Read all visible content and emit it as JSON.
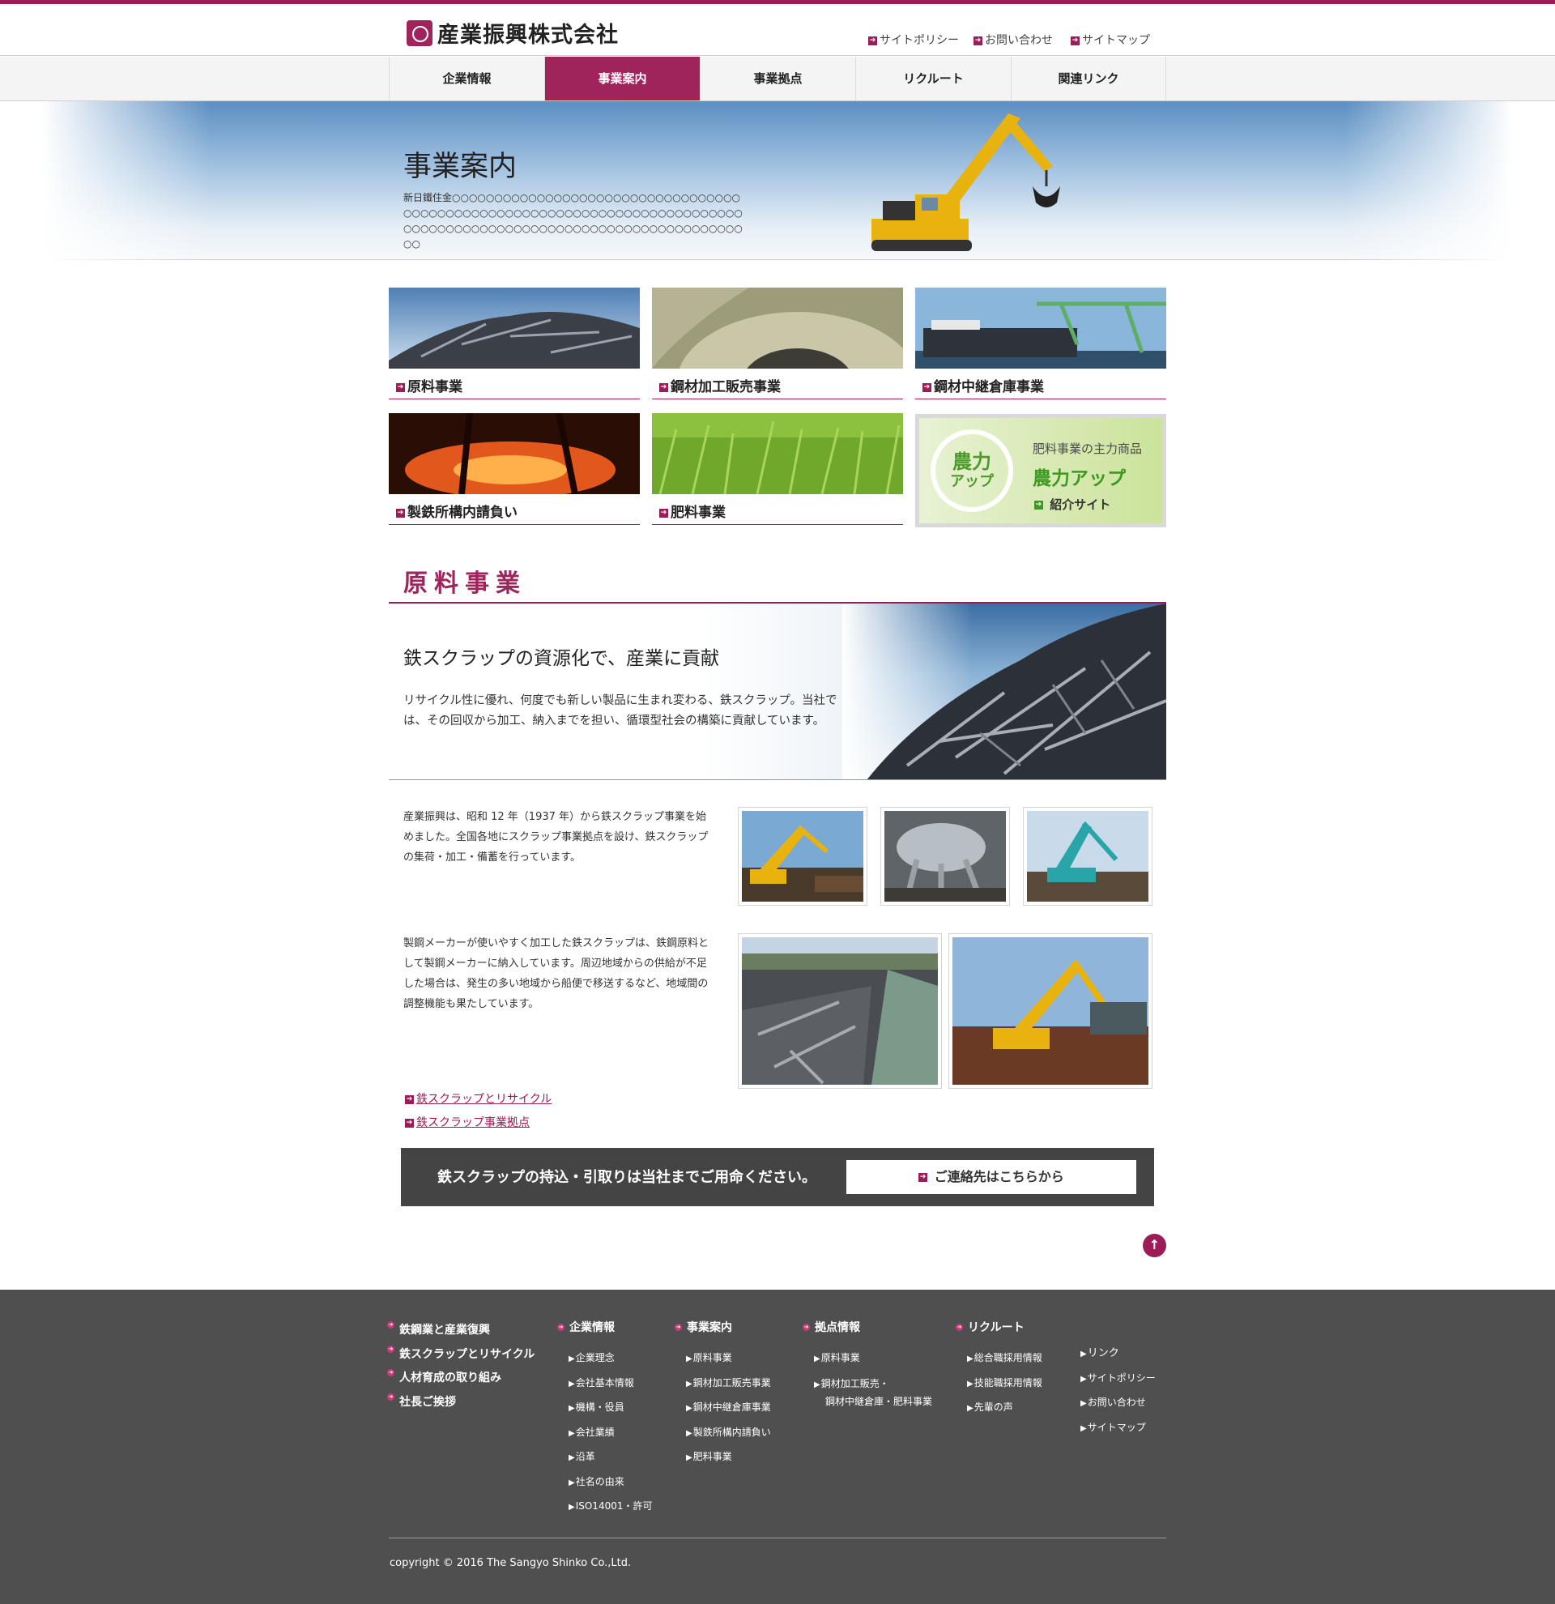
{
  "header": {
    "logo_text": "産業振興株式会社",
    "links": [
      "サイトポリシー",
      "お問い合わせ",
      "サイトマップ"
    ]
  },
  "nav": {
    "items": [
      "企業情報",
      "事業案内",
      "事業拠点",
      "リクルート",
      "関連リンク"
    ],
    "active": "事業案内"
  },
  "hero": {
    "title": "事業案内",
    "text": "新日鐵住金○○○○○○○○○○○○○○○○○○○○○○○○○○○○○○○○○○○○○○○○○○○○○○○○○○○○○○○○○○○○○○○○○○○○○○○○○○○○○○○○○○○○○○○○○○○○○○○○○○○○○○○○○○○○○○○○○○○○"
  },
  "cards": [
    {
      "label": "原料事業"
    },
    {
      "label": "鋼材加工販売事業"
    },
    {
      "label": "鋼材中継倉庫事業"
    },
    {
      "label": "製鉄所構内請負い"
    },
    {
      "label": "肥料事業"
    }
  ],
  "promo": {
    "circle_top": "農力",
    "circle_bottom": "アップ",
    "subtitle": "肥料事業の主力商品",
    "title": "農力アップ",
    "link": "紹介サイト"
  },
  "section": {
    "title": "原料事業",
    "banner_heading": "鉄スクラップの資源化で、産業に貢献",
    "banner_text": "リサイクル性に優れ、何度でも新しい製品に生まれ変わる、鉄スクラップ。当社では、その回収から加工、納入までを担い、循環型社会の構築に貢献しています。",
    "para1": "産業振興は、昭和 12 年（1937 年）から鉄スクラップ事業を始めました。全国各地にスクラップ事業拠点を設け、鉄スクラップの集荷・加工・備蓄を行っています。",
    "para2": "製鋼メーカーが使いやすく加工した鉄スクラップは、鉄鋼原料として製鋼メーカーに納入しています。周辺地域からの供給が不足した場合は、発生の多い地域から船便で移送するなど、地域間の調整機能も果たしています。",
    "links": [
      "鉄スクラップとリサイクル",
      "鉄スクラップ事業拠点"
    ]
  },
  "cta": {
    "text": "鉄スクラップの持込・引取りは当社までご用命ください。",
    "button": "ご連絡先はこちらから"
  },
  "footer": {
    "col1": [
      "鉄鋼業と産業復興",
      "鉄スクラップとリサイクル",
      "人材育成の取り組み",
      "社長ご挨拶"
    ],
    "col2": {
      "head": "企業情報",
      "items": [
        "企業理念",
        "会社基本情報",
        "機構・役員",
        "会社業績",
        "沿革",
        "社名の由来",
        "ISO14001・許可"
      ]
    },
    "col3": {
      "head": "事業案内",
      "items": [
        "原料事業",
        "鋼材加工販売事業",
        "鋼材中継倉庫事業",
        "製鉄所構内請負い",
        "肥料事業"
      ]
    },
    "col4": {
      "head": "拠点情報",
      "items": [
        "原料事業",
        "鋼材加工販売・",
        "鋼材中継倉庫・肥料事業"
      ]
    },
    "col5": {
      "head": "リクルート",
      "items": [
        "総合職採用情報",
        "技能職採用情報",
        "先輩の声"
      ]
    },
    "col6": {
      "items": [
        "リンク",
        "サイトポリシー",
        "お問い合わせ",
        "サイトマップ"
      ]
    },
    "copyright": "copyright © 2016 The Sangyo Shinko Co.,Ltd."
  },
  "colors": {
    "accent": "#9c1c57",
    "footer_bg": "#4f4f4f",
    "cta_bg": "#444444",
    "promo_green": "#3d9a21"
  }
}
